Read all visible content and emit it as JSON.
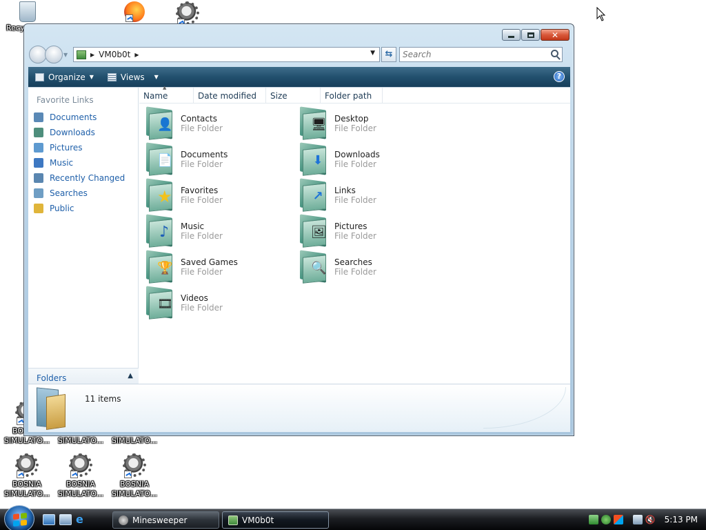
{
  "desktop": {
    "icons": [
      {
        "label": "Recy",
        "kind": "recycle"
      },
      {
        "label": "",
        "kind": "firefox"
      },
      {
        "label": "",
        "kind": "gear"
      },
      {
        "label": "BOSNIA SIMULATO...",
        "kind": "gear"
      },
      {
        "label": "BOSNIA SIMULATO...",
        "kind": "gear"
      },
      {
        "label": "BOSNIA SIMULATO...",
        "kind": "gear"
      },
      {
        "label": "BOSNIA SIMULATO...",
        "kind": "gear"
      },
      {
        "label": "BOSNIA SIMULATO...",
        "kind": "gear"
      },
      {
        "label": "BOSNIA SIMULATO...",
        "kind": "gear"
      }
    ]
  },
  "window": {
    "address": {
      "segments": [
        "VM0b0t"
      ]
    },
    "search": {
      "placeholder": "Search"
    },
    "toolbar": {
      "organize": "Organize",
      "views": "Views"
    },
    "sidebar": {
      "title": "Favorite Links",
      "items": [
        {
          "label": "Documents",
          "color": "#5a89b6"
        },
        {
          "label": "Downloads",
          "color": "#4e8e7c"
        },
        {
          "label": "Pictures",
          "color": "#5e9ad0"
        },
        {
          "label": "Music",
          "color": "#3e78c2"
        },
        {
          "label": "Recently Changed",
          "color": "#5a86b0"
        },
        {
          "label": "Searches",
          "color": "#6f9ec4"
        },
        {
          "label": "Public",
          "color": "#e0b53a"
        }
      ],
      "folders_label": "Folders"
    },
    "columns": [
      "Name",
      "Date modified",
      "Size",
      "Folder path"
    ],
    "items": [
      {
        "name": "Contacts",
        "type": "File Folder",
        "emblem": "👤"
      },
      {
        "name": "Desktop",
        "type": "File Folder",
        "emblem": "🖥"
      },
      {
        "name": "Documents",
        "type": "File Folder",
        "emblem": "📄"
      },
      {
        "name": "Downloads",
        "type": "File Folder",
        "emblem": "⬇"
      },
      {
        "name": "Favorites",
        "type": "File Folder",
        "emblem": "★"
      },
      {
        "name": "Links",
        "type": "File Folder",
        "emblem": "↗"
      },
      {
        "name": "Music",
        "type": "File Folder",
        "emblem": "♪"
      },
      {
        "name": "Pictures",
        "type": "File Folder",
        "emblem": "🖼"
      },
      {
        "name": "Saved Games",
        "type": "File Folder",
        "emblem": "🏆"
      },
      {
        "name": "Searches",
        "type": "File Folder",
        "emblem": "🔍"
      },
      {
        "name": "Videos",
        "type": "File Folder",
        "emblem": "🎞"
      }
    ],
    "details": {
      "count": "11 items"
    }
  },
  "taskbar": {
    "tasks": [
      {
        "label": "Minesweeper",
        "active": false
      },
      {
        "label": "VM0b0t",
        "active": true
      }
    ],
    "clock": "5:13 PM"
  }
}
